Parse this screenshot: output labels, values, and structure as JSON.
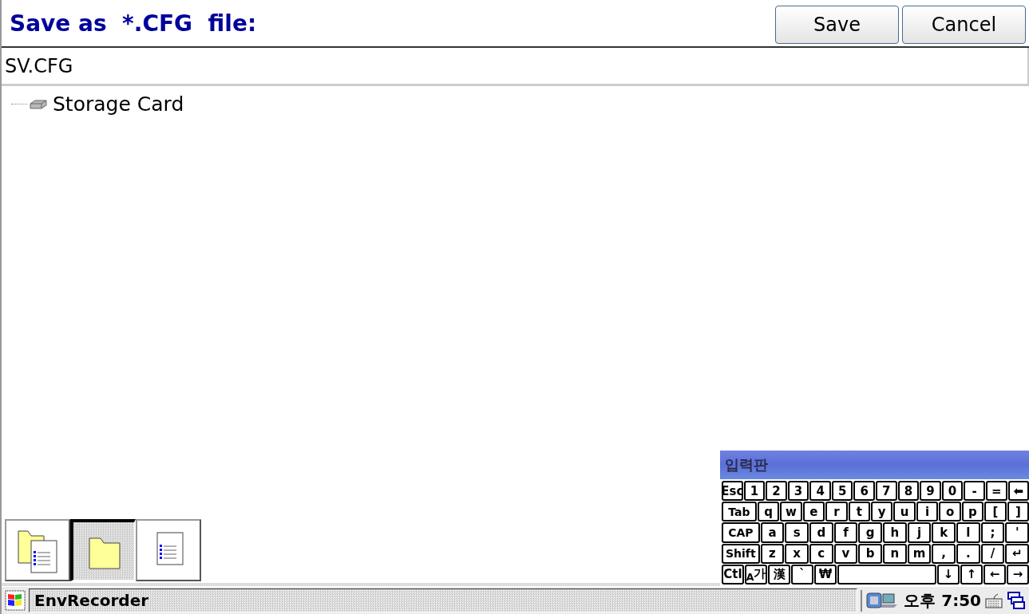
{
  "title": "Save as  *.CFG  file:",
  "buttons": [
    {
      "label": "Save"
    },
    {
      "label": "Cancel"
    }
  ],
  "filename": {
    "value": "SV.CFG"
  },
  "tree": [
    {
      "label": "Storage Card"
    }
  ],
  "view_buttons": [
    {
      "kind": "folder-list",
      "selected": false
    },
    {
      "kind": "folder",
      "selected": true
    },
    {
      "kind": "list",
      "selected": false
    }
  ],
  "input_panel": {
    "title": "입력판",
    "rows": [
      {
        "keys": [
          {
            "label": "Esc",
            "kind": "key"
          },
          {
            "label": "1",
            "kind": "key"
          },
          {
            "label": "2",
            "kind": "key"
          },
          {
            "label": "3",
            "kind": "key"
          },
          {
            "label": "4",
            "kind": "key"
          },
          {
            "label": "5",
            "kind": "key"
          },
          {
            "label": "6",
            "kind": "key"
          },
          {
            "label": "7",
            "kind": "key"
          },
          {
            "label": "8",
            "kind": "key"
          },
          {
            "label": "9",
            "kind": "key"
          },
          {
            "label": "0",
            "kind": "key"
          },
          {
            "label": "-",
            "kind": "key"
          },
          {
            "label": "=",
            "kind": "key"
          },
          {
            "label": "⬅",
            "kind": "key"
          }
        ]
      },
      {
        "keys": [
          {
            "label": "Tab",
            "kind": "wide"
          },
          {
            "label": "q",
            "kind": "key"
          },
          {
            "label": "w",
            "kind": "key"
          },
          {
            "label": "e",
            "kind": "key"
          },
          {
            "label": "r",
            "kind": "key"
          },
          {
            "label": "t",
            "kind": "key"
          },
          {
            "label": "y",
            "kind": "key"
          },
          {
            "label": "u",
            "kind": "key"
          },
          {
            "label": "i",
            "kind": "key"
          },
          {
            "label": "o",
            "kind": "key"
          },
          {
            "label": "p",
            "kind": "key"
          },
          {
            "label": "[",
            "kind": "key"
          },
          {
            "label": "]",
            "kind": "key"
          }
        ]
      },
      {
        "keys": [
          {
            "label": "CAP",
            "kind": "wide"
          },
          {
            "label": "a",
            "kind": "key"
          },
          {
            "label": "s",
            "kind": "key"
          },
          {
            "label": "d",
            "kind": "key"
          },
          {
            "label": "f",
            "kind": "key"
          },
          {
            "label": "g",
            "kind": "key"
          },
          {
            "label": "h",
            "kind": "key"
          },
          {
            "label": "j",
            "kind": "key"
          },
          {
            "label": "k",
            "kind": "key"
          },
          {
            "label": "l",
            "kind": "key"
          },
          {
            "label": ";",
            "kind": "key"
          },
          {
            "label": "'",
            "kind": "key"
          }
        ]
      },
      {
        "keys": [
          {
            "label": "Shift",
            "kind": "wide"
          },
          {
            "label": "z",
            "kind": "key"
          },
          {
            "label": "x",
            "kind": "key"
          },
          {
            "label": "c",
            "kind": "key"
          },
          {
            "label": "v",
            "kind": "key"
          },
          {
            "label": "b",
            "kind": "key"
          },
          {
            "label": "n",
            "kind": "key"
          },
          {
            "label": "m",
            "kind": "key"
          },
          {
            "label": ",",
            "kind": "key"
          },
          {
            "label": ".",
            "kind": "key"
          },
          {
            "label": "/",
            "kind": "key"
          },
          {
            "label": "↵",
            "kind": "key"
          }
        ]
      },
      {
        "keys": [
          {
            "label": "Ctl",
            "kind": "key"
          },
          {
            "label": "$_{A}$가",
            "kind": "key"
          },
          {
            "label": "漢",
            "kind": "key"
          },
          {
            "label": "`",
            "kind": "key"
          },
          {
            "label": "₩",
            "kind": "key"
          },
          {
            "kind": "space"
          },
          {
            "label": "↓",
            "kind": "key"
          },
          {
            "label": "↑",
            "kind": "key"
          },
          {
            "label": "←",
            "kind": "key"
          },
          {
            "label": "→",
            "kind": "key"
          }
        ]
      }
    ]
  },
  "taskbar": {
    "task": {
      "label": "EnvRecorder",
      "selected": true
    },
    "time": "오후 7:50"
  }
}
